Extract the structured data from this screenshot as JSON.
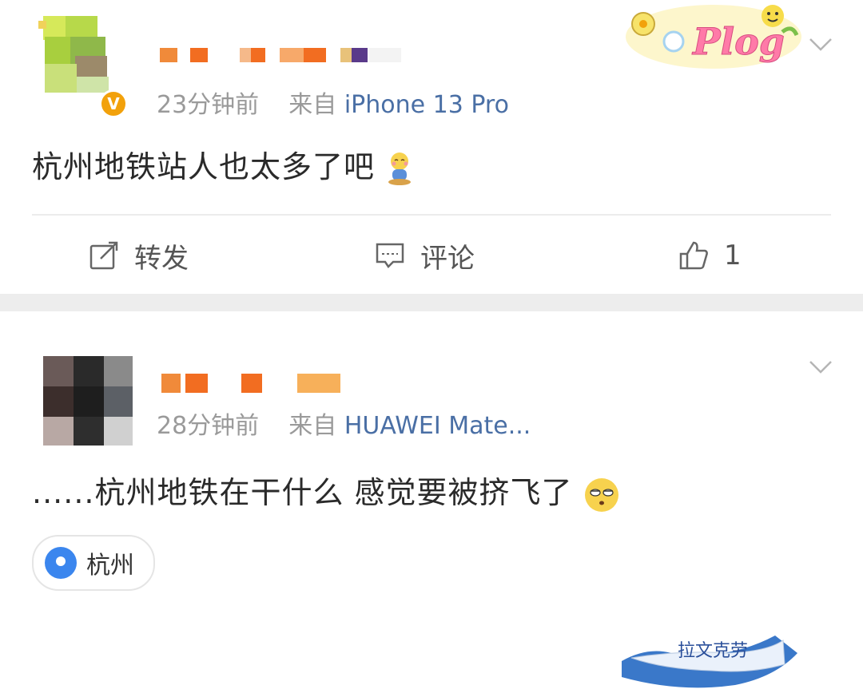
{
  "posts": [
    {
      "time": "23分钟前",
      "source_prefix": "来自",
      "source": "iPhone 13 Pro",
      "text": "杭州地铁站人也太多了吧",
      "verified_mark": "V",
      "badge_text": "Plog",
      "actions": {
        "repost": "转发",
        "comment": "评论",
        "like_count": "1"
      }
    },
    {
      "time": "28分钟前",
      "source_prefix": "来自",
      "source": "HUAWEI Mate...",
      "text": "......杭州地铁在干什么 感觉要被挤飞了",
      "badge_text": "拉文克劳",
      "location": "杭州"
    }
  ],
  "colors": {
    "accent_orange": "#f2a10b",
    "link_blue": "#4a6fa5",
    "pin_blue": "#3b86ee"
  }
}
